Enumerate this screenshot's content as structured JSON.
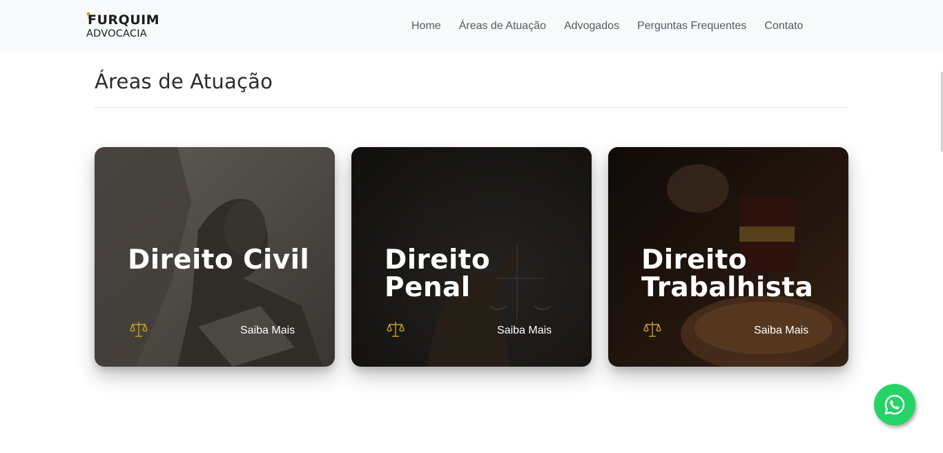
{
  "navbar": {
    "logo_top": "FURQUIM",
    "logo_bottom": "ADVOCACIA",
    "links": [
      "Home",
      "Áreas de Atuação",
      "Advogados",
      "Perguntas Frequentes",
      "Contato"
    ]
  },
  "section": {
    "title": "Áreas de Atuação"
  },
  "cards": [
    {
      "title": "Direito Civil",
      "link": "Saiba Mais",
      "icon": "scales-icon"
    },
    {
      "title": "Direito Penal",
      "link": "Saiba Mais",
      "icon": "scales-icon"
    },
    {
      "title": "Direito Trabalhista",
      "link": "Saiba Mais",
      "icon": "scales-icon"
    }
  ],
  "whatsapp": {
    "icon": "whatsapp-icon"
  },
  "colors": {
    "accent_gold": "#c9a227",
    "nav_bg": "#f8f9fa",
    "whatsapp_green": "#25d366"
  }
}
